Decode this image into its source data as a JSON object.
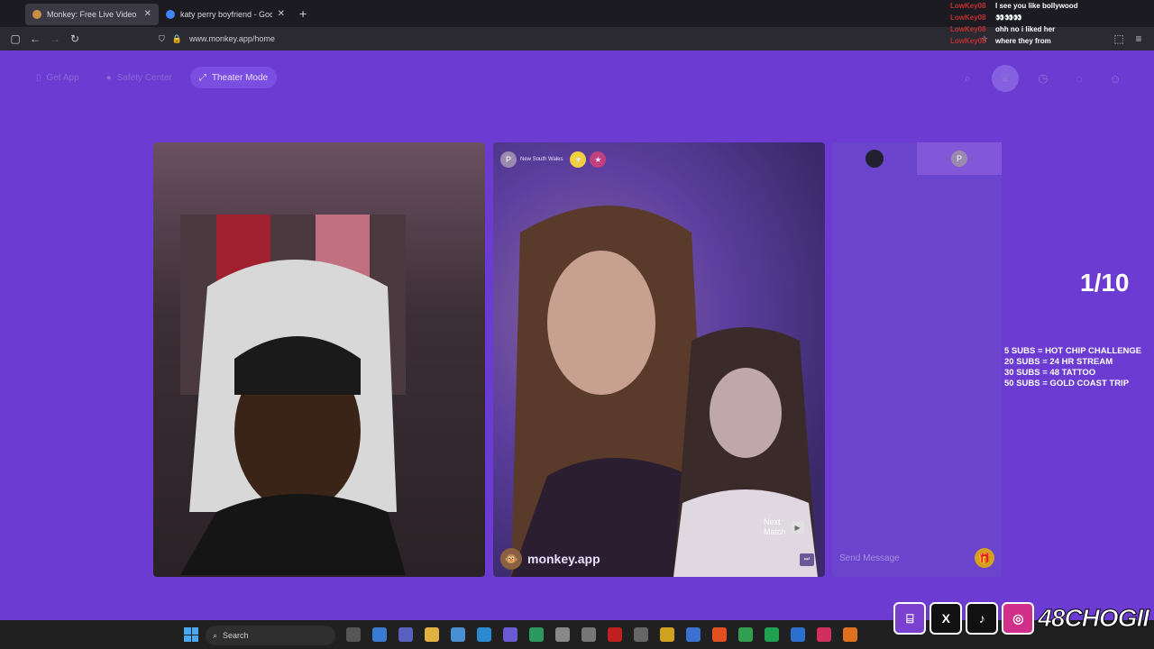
{
  "browser": {
    "tabs": [
      {
        "title": "Monkey: Free Live Video Ch",
        "active": true
      },
      {
        "title": "katy perry boyfriend - Google S",
        "active": false
      }
    ],
    "new_tab": "+",
    "url": "www.monkey.app/home"
  },
  "stream_chat": [
    {
      "user": "LowKey08",
      "message": "I see you like bollywood"
    },
    {
      "user": "LowKey08",
      "message": "👀👀👀"
    },
    {
      "user": "LowKey08",
      "message": "ohh no i liked her"
    },
    {
      "user": "LowKey08",
      "message": "where they from"
    }
  ],
  "topnav": {
    "get_app": "Get App",
    "safety_center": "Safety Center",
    "theater_mode": "Theater Mode"
  },
  "partner_video": {
    "avatar_letter": "P",
    "location": "New South Wales",
    "next_match_line1": "Next",
    "next_match_line2": "Match",
    "brand": "monkey.app"
  },
  "chat_panel": {
    "tab2_letter": "P",
    "placeholder": "Send Message"
  },
  "stream_overlay": {
    "counter": "1/10",
    "goals": [
      "5 SUBS = HOT CHIP CHALLENGE",
      "20 SUBS = 24 HR STREAM",
      "30 SUBS = 48 TATTOO",
      "50 SUBS = GOLD COAST TRIP"
    ],
    "handle": "48CHOGII"
  },
  "taskbar": {
    "search": "Search"
  },
  "colors": {
    "page_bg": "#6c3bd1",
    "chat_panel": "#6a44cc",
    "accent": "#7a4ee0"
  }
}
